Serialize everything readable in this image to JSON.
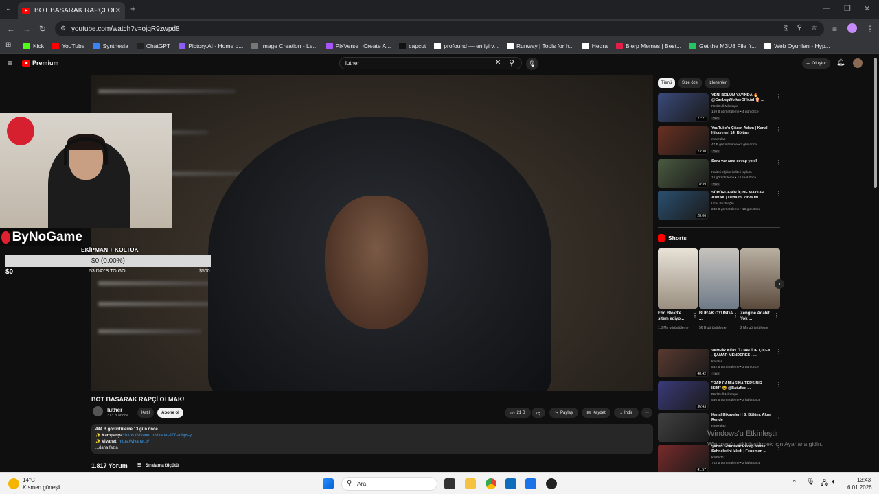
{
  "browser": {
    "tab_title": "BOT BASARAK RAPÇİ OLMAK!",
    "url": "youtube.com/watch?v=ojqR9zwpd8",
    "bookmarks": [
      {
        "label": "Kick",
        "color": "#53fc18"
      },
      {
        "label": "YouTube",
        "color": "#ff0000"
      },
      {
        "label": "Synthesia",
        "color": "#3b82f6"
      },
      {
        "label": "ChatGPT",
        "color": "#222222"
      },
      {
        "label": "Pictory.AI - Home o...",
        "color": "#8b5cf6"
      },
      {
        "label": "Image Creation - Le...",
        "color": "#777777"
      },
      {
        "label": "PixVerse | Create A...",
        "color": "#a855f7"
      },
      {
        "label": "capcut",
        "color": "#111111"
      },
      {
        "label": "profound — en iyi v...",
        "color": "#ffffff"
      },
      {
        "label": "Runway | Tools for h...",
        "color": "#ffffff"
      },
      {
        "label": "Hedra",
        "color": "#ffffff"
      },
      {
        "label": "Blerp Memes | Best...",
        "color": "#e11d48"
      },
      {
        "label": "Get the M3U8 File fr...",
        "color": "#22c55e"
      },
      {
        "label": "Web Oyunları - Hyp...",
        "color": "#ffffff"
      }
    ]
  },
  "youtube": {
    "logo_label": "Premium",
    "search_value": "luther",
    "create_label": "Oluştur"
  },
  "stream_overlay": {
    "brand": "ByNoGame",
    "goal_title": "EKİPMAN + KOLTUK",
    "goal_amount": "$0 (0.00%)",
    "goal_current": "$0",
    "goal_days": "53 DAYS TO GO",
    "goal_max": "$500",
    "goal_progress": 0
  },
  "video": {
    "title": "BOT BASARAK RAPÇİ OLMAK!",
    "channel": "luther",
    "subscribers": "313 B abone",
    "join_label": "Katıl",
    "subscribe_label": "Abone ol",
    "likes": "21 B",
    "share_label": "Paylaş",
    "save_label": "Kaydet",
    "download_label": "İndir",
    "desc_stats": "444 B görüntüleme  13 gün önce",
    "desc_line1_label": "Kampanya:",
    "desc_line1_link": "https://vivanet.tr/vivanet-100-mbps-y...",
    "desc_line2_label": "Vivanet:",
    "desc_line2_link": "https://vivanet.tr/",
    "desc_more": "...daha fazla",
    "comments_count": "1.817 Yorum",
    "sort_label": "Sıralama ölçütü"
  },
  "sidebar": {
    "chips": [
      "Tümü",
      "Size özel",
      "İzlenenler"
    ],
    "recommendations_top": [
      {
        "title": "YENİ BÖLÜM YAYINDA 🔥 @CanbeyWolkerOfficial 🍿 ...",
        "channel": "Red Bull Mikstape",
        "meta": "169 B görüntüleme • 4 gün önce",
        "duration": "27:21",
        "badge": "Yeni"
      },
      {
        "title": "YouTube'u Çözen Adam | Kanal Hikayeleri 14. Bölüm",
        "channel": "mevzulab",
        "meta": "47 B görüntüleme • 3 gün önce",
        "duration": "23:30",
        "badge": "Yeni"
      },
      {
        "title": "Soru var ama cevap yok!!",
        "channel": "Kaliteli eğitim kaliteli toplum",
        "meta": "16 görüntüleme • 14 saat önce",
        "duration": "8:39",
        "badge": "Yeni"
      },
      {
        "title": "SÜPÜRGENİN İÇİNE MAYTAP ATMAK | Deha mı Zırva mı",
        "channel": "Ucar Bozlüoğlu",
        "meta": "248 B görüntüleme • 10 gün önce",
        "duration": "28:06",
        "badge": ""
      }
    ],
    "shorts_heading": "Shorts",
    "shorts": [
      {
        "title": "Ebo Blok3'e sitem ediyo...",
        "views": "1,8 Mn görüntüleme"
      },
      {
        "title": "BURAK OYUNDA ...",
        "views": "56 B görüntüleme"
      },
      {
        "title": "Zengine Adalet Yok ...",
        "views": "2 Mn görüntüleme"
      }
    ],
    "recommendations_bottom": [
      {
        "title": "VAMPİR KÖYLÜ / NADİDE ÇİÇEK - ŞAMAR MENDERES - ...",
        "channel": "Kafalar",
        "meta": "532 B görüntüleme • 3 gün önce",
        "duration": "48:42",
        "badge": "Yeni"
      },
      {
        "title": "\"RAP CAMİASINA TERS BİR İSİM\" 😂 @Batuflex ...",
        "channel": "Red Bull Mikstape",
        "meta": "536 B görüntüleme • 2 hafta önce",
        "duration": "36:43",
        "badge": ""
      },
      {
        "title": "Kanal Hikayeleri | 8. Bölüm: Alper Rende",
        "channel": "mevzulab",
        "meta": "",
        "duration": "",
        "badge": ""
      },
      {
        "title": "Şahan Gökbakar Recep İvedik Sahnelerini İzledi | Fenomen ...",
        "channel": "KAFA TV",
        "meta": "753 B görüntüleme • 2 hafta önce",
        "duration": "41:57",
        "badge": ""
      }
    ]
  },
  "windows": {
    "activation_title": "Windows'u Etkinleştir",
    "activation_text": "Windows'u etkinleştirmek için Ayarlar'a gidin.",
    "weather_temp": "14°C",
    "weather_desc": "Kısmen güneşli",
    "search_placeholder": "Ara",
    "time": "13:43",
    "date": "6.01.2026"
  }
}
